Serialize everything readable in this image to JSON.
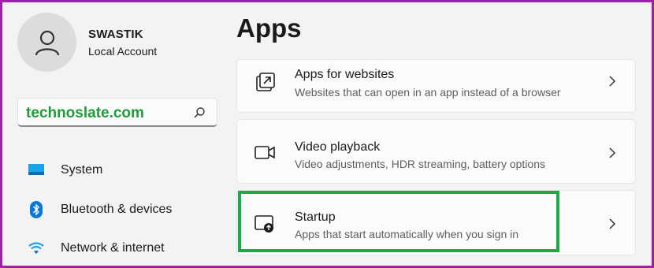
{
  "account": {
    "name": "SWASTIK",
    "type": "Local Account"
  },
  "search": {
    "value": "technoslate.com",
    "icon": "search-icon"
  },
  "sidebar": {
    "items": [
      {
        "label": "System",
        "icon": "monitor-icon"
      },
      {
        "label": "Bluetooth & devices",
        "icon": "bluetooth-icon"
      },
      {
        "label": "Network & internet",
        "icon": "wifi-icon"
      }
    ]
  },
  "page": {
    "title": "Apps"
  },
  "settings": {
    "items": [
      {
        "title": "Apps for websites",
        "subtitle": "Websites that can open in an app instead of a browser",
        "icon": "open-external-icon"
      },
      {
        "title": "Video playback",
        "subtitle": "Video adjustments, HDR streaming, battery options",
        "icon": "video-camera-icon"
      },
      {
        "title": "Startup",
        "subtitle": "Apps that start automatically when you sign in",
        "icon": "startup-icon"
      }
    ]
  },
  "colors": {
    "border_frame": "#a020a8",
    "highlight": "#1fa84a",
    "watermark_text": "#1e9b3a"
  }
}
